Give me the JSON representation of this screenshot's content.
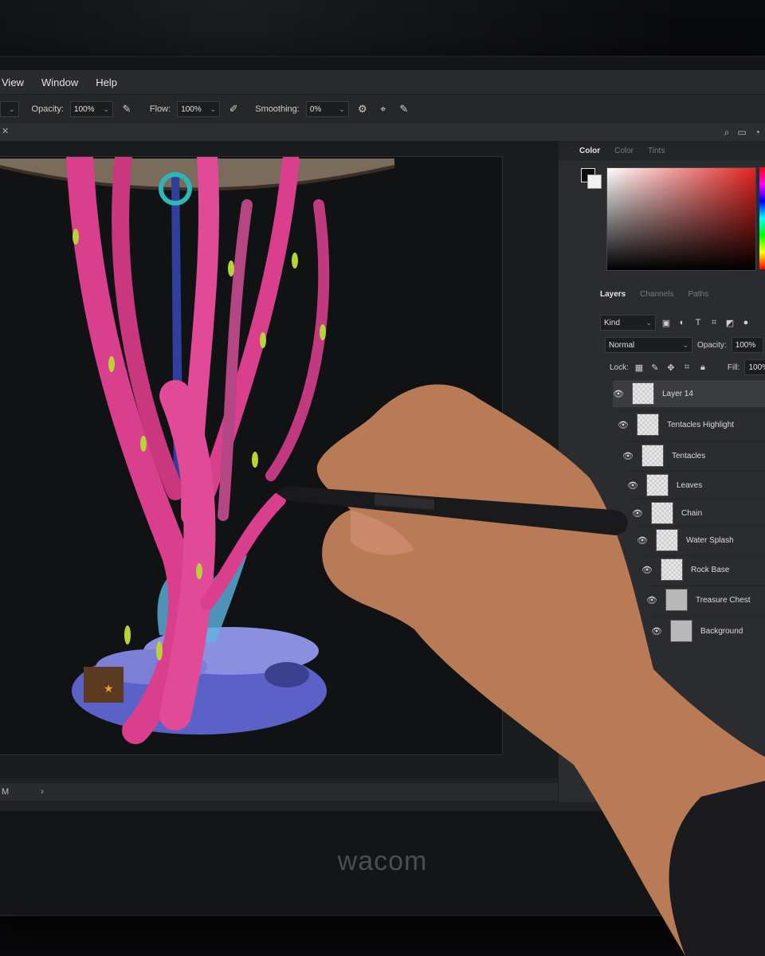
{
  "menu": [
    "View",
    "Window",
    "Help"
  ],
  "options": {
    "opacity_label": "Opacity:",
    "opacity_value": "100%",
    "flow_label": "Flow:",
    "flow_value": "100%",
    "smoothing_label": "Smoothing:",
    "smoothing_value": "0%"
  },
  "color_panel": {
    "tabs": [
      "Color",
      "Color",
      "Tints"
    ],
    "foreground": "#0d0d0d",
    "background": "#f1f1f1",
    "picker_hue": "#e2241f"
  },
  "layers_panel": {
    "tabs": [
      "Layers",
      "Channels",
      "Paths"
    ],
    "filter_value": "Kind",
    "blend_mode": "Normal",
    "opacity_label": "Opacity:",
    "opacity_value": "100%",
    "lock_label": "Lock:",
    "fill_label": "Fill:",
    "fill_value": "100%",
    "layers": [
      {
        "name": "Layer 14",
        "selected": true
      },
      {
        "name": "Tentacles Highlight"
      },
      {
        "name": "Tentacles"
      },
      {
        "name": "Leaves"
      },
      {
        "name": "Chain"
      },
      {
        "name": "Water Splash"
      },
      {
        "name": "Rock Base"
      },
      {
        "name": "Treasure Chest"
      },
      {
        "name": "Background"
      }
    ]
  },
  "status": {
    "left": "M",
    "arrow": "›"
  },
  "device_brand": "wacom"
}
